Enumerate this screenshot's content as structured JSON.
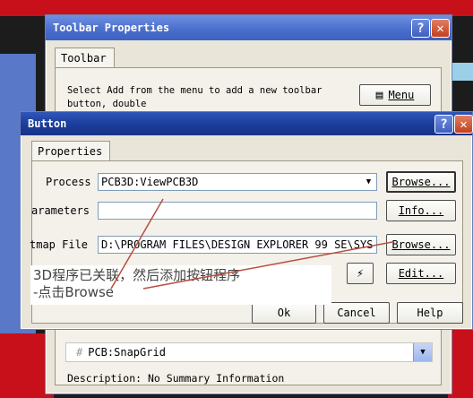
{
  "back_window": {
    "title": "Toolbar Properties",
    "tab": "Toolbar",
    "instruction": "Select Add from the menu to add a new toolbar button, double",
    "menu_button": "Menu",
    "menu_button_accel": "M",
    "list_item": "PCB:SnapGrid",
    "description": "Description: No Summary Information"
  },
  "front_window": {
    "title": "Button",
    "tab": "Properties",
    "process_label": "Process",
    "process_value": "PCB3D:ViewPCB3D",
    "browse_button": "Browse...",
    "parameters_label": "arameters",
    "parameters_value": "",
    "info_button": "Info...",
    "bitmap_label": "tmap File",
    "bitmap_value": "D:\\PROGRAM FILES\\DESIGN EXPLORER 99 SE\\SYS",
    "browse2_button": "Browse...",
    "edit_button": "Edit...",
    "ok_button": "Ok",
    "cancel_button": "Cancel",
    "help_button": "Help"
  },
  "annotation": {
    "line1": "3D程序已关联，然后添加按钮程序",
    "line2": "-点击Browse"
  },
  "colors": {
    "title_active": "#1b3c9a",
    "title_inactive": "#4b6fcd",
    "dialog_bg": "#e9e5d9",
    "close_red": "#c2401f"
  }
}
